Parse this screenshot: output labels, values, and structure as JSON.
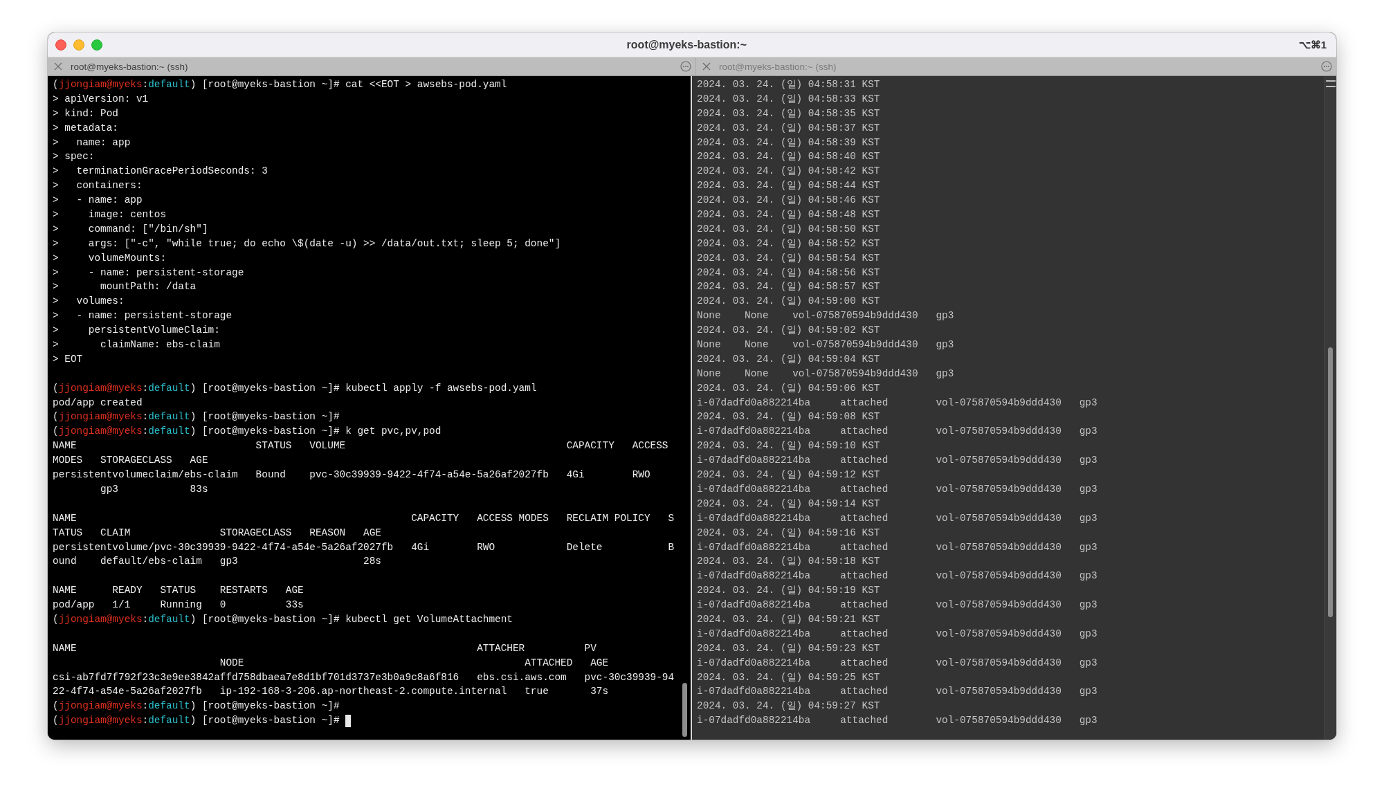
{
  "window": {
    "title": "root@myeks-bastion:~",
    "shortcut": "⌥⌘1"
  },
  "panes": [
    {
      "tab": {
        "label": "root@myeks-bastion:~ (ssh)",
        "selected": true
      },
      "lines": [
        {
          "kind": "prompt",
          "parts": [
            {
              "kind": "plain",
              "text": "("
            },
            {
              "kind": "user",
              "text": "jjongiam@myeks"
            },
            {
              "kind": "plain",
              "text": ":"
            },
            {
              "kind": "namespace",
              "text": "default"
            },
            {
              "kind": "plain",
              "text": ") [root@myeks-bastion ~]# cat <<EOT > awsebs-pod.yaml"
            }
          ]
        },
        {
          "kind": "output",
          "text": "> apiVersion: v1"
        },
        {
          "kind": "output",
          "text": "> kind: Pod"
        },
        {
          "kind": "output",
          "text": "> metadata:"
        },
        {
          "kind": "output",
          "text": ">   name: app"
        },
        {
          "kind": "output",
          "text": "> spec:"
        },
        {
          "kind": "output",
          "text": ">   terminationGracePeriodSeconds: 3"
        },
        {
          "kind": "output",
          "text": ">   containers:"
        },
        {
          "kind": "output",
          "text": ">   - name: app"
        },
        {
          "kind": "output",
          "text": ">     image: centos"
        },
        {
          "kind": "output",
          "text": ">     command: [\"/bin/sh\"]"
        },
        {
          "kind": "output",
          "text": ">     args: [\"-c\", \"while true; do echo \\$(date -u) >> /data/out.txt; sleep 5; done\"]"
        },
        {
          "kind": "output",
          "text": ">     volumeMounts:"
        },
        {
          "kind": "output",
          "text": ">     - name: persistent-storage"
        },
        {
          "kind": "output",
          "text": ">       mountPath: /data"
        },
        {
          "kind": "output",
          "text": ">   volumes:"
        },
        {
          "kind": "output",
          "text": ">   - name: persistent-storage"
        },
        {
          "kind": "output",
          "text": ">     persistentVolumeClaim:"
        },
        {
          "kind": "output",
          "text": ">       claimName: ebs-claim"
        },
        {
          "kind": "output",
          "text": "> EOT"
        },
        {
          "kind": "blank"
        },
        {
          "kind": "prompt",
          "parts": [
            {
              "kind": "plain",
              "text": "("
            },
            {
              "kind": "user",
              "text": "jjongiam@myeks"
            },
            {
              "kind": "plain",
              "text": ":"
            },
            {
              "kind": "namespace",
              "text": "default"
            },
            {
              "kind": "plain",
              "text": ") [root@myeks-bastion ~]# kubectl apply -f awsebs-pod.yaml"
            }
          ]
        },
        {
          "kind": "output",
          "text": "pod/app created"
        },
        {
          "kind": "prompt",
          "parts": [
            {
              "kind": "plain",
              "text": "("
            },
            {
              "kind": "user",
              "text": "jjongiam@myeks"
            },
            {
              "kind": "plain",
              "text": ":"
            },
            {
              "kind": "namespace",
              "text": "default"
            },
            {
              "kind": "plain",
              "text": ") [root@myeks-bastion ~]#"
            }
          ]
        },
        {
          "kind": "prompt",
          "parts": [
            {
              "kind": "plain",
              "text": "("
            },
            {
              "kind": "user",
              "text": "jjongiam@myeks"
            },
            {
              "kind": "plain",
              "text": ":"
            },
            {
              "kind": "namespace",
              "text": "default"
            },
            {
              "kind": "plain",
              "text": ") [root@myeks-bastion ~]# k get pvc,pv,pod"
            }
          ]
        },
        {
          "kind": "output",
          "text": "NAME                              STATUS   VOLUME                                     CAPACITY   ACCESS"
        },
        {
          "kind": "output",
          "text": "MODES   STORAGECLASS   AGE"
        },
        {
          "kind": "output",
          "text": "persistentvolumeclaim/ebs-claim   Bound    pvc-30c39939-9422-4f74-a54e-5a26af2027fb   4Gi        RWO"
        },
        {
          "kind": "output",
          "text": "        gp3            83s"
        },
        {
          "kind": "blank"
        },
        {
          "kind": "output",
          "text": "NAME                                                        CAPACITY   ACCESS MODES   RECLAIM POLICY   S"
        },
        {
          "kind": "output",
          "text": "TATUS   CLAIM               STORAGECLASS   REASON   AGE"
        },
        {
          "kind": "output",
          "text": "persistentvolume/pvc-30c39939-9422-4f74-a54e-5a26af2027fb   4Gi        RWO            Delete           B"
        },
        {
          "kind": "output",
          "text": "ound    default/ebs-claim   gp3                     28s"
        },
        {
          "kind": "blank"
        },
        {
          "kind": "output",
          "text": "NAME      READY   STATUS    RESTARTS   AGE"
        },
        {
          "kind": "output",
          "text": "pod/app   1/1     Running   0          33s"
        },
        {
          "kind": "prompt",
          "parts": [
            {
              "kind": "plain",
              "text": "("
            },
            {
              "kind": "user",
              "text": "jjongiam@myeks"
            },
            {
              "kind": "plain",
              "text": ":"
            },
            {
              "kind": "namespace",
              "text": "default"
            },
            {
              "kind": "plain",
              "text": ") [root@myeks-bastion ~]# kubectl get VolumeAttachment"
            }
          ]
        },
        {
          "kind": "blank"
        },
        {
          "kind": "output",
          "text": "NAME                                                                   ATTACHER          PV"
        },
        {
          "kind": "output",
          "text": "                            NODE                                               ATTACHED   AGE"
        },
        {
          "kind": "output",
          "text": "csi-ab7fd7f792f23c3e9ee3842affd758dbaea7e8d1bf701d3737e3b0a9c8a6f816   ebs.csi.aws.com   pvc-30c39939-94"
        },
        {
          "kind": "output",
          "text": "22-4f74-a54e-5a26af2027fb   ip-192-168-3-206.ap-northeast-2.compute.internal   true       37s"
        },
        {
          "kind": "prompt",
          "parts": [
            {
              "kind": "plain",
              "text": "("
            },
            {
              "kind": "user",
              "text": "jjongiam@myeks"
            },
            {
              "kind": "plain",
              "text": ":"
            },
            {
              "kind": "namespace",
              "text": "default"
            },
            {
              "kind": "plain",
              "text": ") [root@myeks-bastion ~]#"
            }
          ]
        },
        {
          "kind": "prompt",
          "cursor": true,
          "parts": [
            {
              "kind": "plain",
              "text": "("
            },
            {
              "kind": "user",
              "text": "jjongiam@myeks"
            },
            {
              "kind": "plain",
              "text": ":"
            },
            {
              "kind": "namespace",
              "text": "default"
            },
            {
              "kind": "plain",
              "text": ") [root@myeks-bastion ~]# "
            }
          ]
        }
      ]
    },
    {
      "tab": {
        "label": "root@myeks-bastion:~ (ssh)",
        "selected": false
      },
      "lines": [
        {
          "kind": "output",
          "text": "2024. 03. 24. (일) 04:58:31 KST"
        },
        {
          "kind": "output",
          "text": "2024. 03. 24. (일) 04:58:33 KST"
        },
        {
          "kind": "output",
          "text": "2024. 03. 24. (일) 04:58:35 KST"
        },
        {
          "kind": "output",
          "text": "2024. 03. 24. (일) 04:58:37 KST"
        },
        {
          "kind": "output",
          "text": "2024. 03. 24. (일) 04:58:39 KST"
        },
        {
          "kind": "output",
          "text": "2024. 03. 24. (일) 04:58:40 KST"
        },
        {
          "kind": "output",
          "text": "2024. 03. 24. (일) 04:58:42 KST"
        },
        {
          "kind": "output",
          "text": "2024. 03. 24. (일) 04:58:44 KST"
        },
        {
          "kind": "output",
          "text": "2024. 03. 24. (일) 04:58:46 KST"
        },
        {
          "kind": "output",
          "text": "2024. 03. 24. (일) 04:58:48 KST"
        },
        {
          "kind": "output",
          "text": "2024. 03. 24. (일) 04:58:50 KST"
        },
        {
          "kind": "output",
          "text": "2024. 03. 24. (일) 04:58:52 KST"
        },
        {
          "kind": "output",
          "text": "2024. 03. 24. (일) 04:58:54 KST"
        },
        {
          "kind": "output",
          "text": "2024. 03. 24. (일) 04:58:56 KST"
        },
        {
          "kind": "output",
          "text": "2024. 03. 24. (일) 04:58:57 KST"
        },
        {
          "kind": "output",
          "text": "2024. 03. 24. (일) 04:59:00 KST"
        },
        {
          "kind": "output",
          "text": "None    None    vol-075870594b9ddd430   gp3"
        },
        {
          "kind": "output",
          "text": "2024. 03. 24. (일) 04:59:02 KST"
        },
        {
          "kind": "output",
          "text": "None    None    vol-075870594b9ddd430   gp3"
        },
        {
          "kind": "output",
          "text": "2024. 03. 24. (일) 04:59:04 KST"
        },
        {
          "kind": "output",
          "text": "None    None    vol-075870594b9ddd430   gp3"
        },
        {
          "kind": "output",
          "text": "2024. 03. 24. (일) 04:59:06 KST"
        },
        {
          "kind": "output",
          "text": "i-07dadfd0a882214ba     attached        vol-075870594b9ddd430   gp3"
        },
        {
          "kind": "output",
          "text": "2024. 03. 24. (일) 04:59:08 KST"
        },
        {
          "kind": "output",
          "text": "i-07dadfd0a882214ba     attached        vol-075870594b9ddd430   gp3"
        },
        {
          "kind": "output",
          "text": "2024. 03. 24. (일) 04:59:10 KST"
        },
        {
          "kind": "output",
          "text": "i-07dadfd0a882214ba     attached        vol-075870594b9ddd430   gp3"
        },
        {
          "kind": "output",
          "text": "2024. 03. 24. (일) 04:59:12 KST"
        },
        {
          "kind": "output",
          "text": "i-07dadfd0a882214ba     attached        vol-075870594b9ddd430   gp3"
        },
        {
          "kind": "output",
          "text": "2024. 03. 24. (일) 04:59:14 KST"
        },
        {
          "kind": "output",
          "text": "i-07dadfd0a882214ba     attached        vol-075870594b9ddd430   gp3"
        },
        {
          "kind": "output",
          "text": "2024. 03. 24. (일) 04:59:16 KST"
        },
        {
          "kind": "output",
          "text": "i-07dadfd0a882214ba     attached        vol-075870594b9ddd430   gp3"
        },
        {
          "kind": "output",
          "text": "2024. 03. 24. (일) 04:59:18 KST"
        },
        {
          "kind": "output",
          "text": "i-07dadfd0a882214ba     attached        vol-075870594b9ddd430   gp3"
        },
        {
          "kind": "output",
          "text": "2024. 03. 24. (일) 04:59:19 KST"
        },
        {
          "kind": "output",
          "text": "i-07dadfd0a882214ba     attached        vol-075870594b9ddd430   gp3"
        },
        {
          "kind": "output",
          "text": "2024. 03. 24. (일) 04:59:21 KST"
        },
        {
          "kind": "output",
          "text": "i-07dadfd0a882214ba     attached        vol-075870594b9ddd430   gp3"
        },
        {
          "kind": "output",
          "text": "2024. 03. 24. (일) 04:59:23 KST"
        },
        {
          "kind": "output",
          "text": "i-07dadfd0a882214ba     attached        vol-075870594b9ddd430   gp3"
        },
        {
          "kind": "output",
          "text": "2024. 03. 24. (일) 04:59:25 KST"
        },
        {
          "kind": "output",
          "text": "i-07dadfd0a882214ba     attached        vol-075870594b9ddd430   gp3"
        },
        {
          "kind": "output",
          "text": "2024. 03. 24. (일) 04:59:27 KST"
        },
        {
          "kind": "output",
          "text": "i-07dadfd0a882214ba     attached        vol-075870594b9ddd430   gp3"
        }
      ]
    }
  ]
}
